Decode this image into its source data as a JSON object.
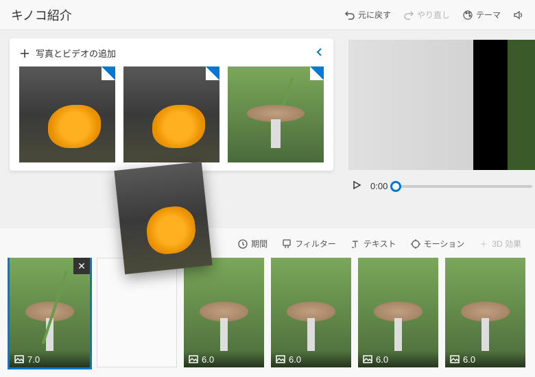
{
  "header": {
    "title": "キノコ紹介",
    "undo": "元に戻す",
    "redo": "やり直し",
    "theme": "テーマ"
  },
  "library": {
    "add_media": "写真とビデオの追加"
  },
  "player": {
    "time": "0:00"
  },
  "edit_tools": {
    "duration": "期間",
    "filter": "フィルター",
    "text": "テキスト",
    "motion": "モーション",
    "effects3d": "3D 効果"
  },
  "clips": [
    {
      "duration": "7.0",
      "selected": true
    },
    {
      "placeholder": true
    },
    {
      "duration": "6.0"
    },
    {
      "duration": "6.0"
    },
    {
      "duration": "6.0"
    },
    {
      "duration": "6.0"
    }
  ]
}
